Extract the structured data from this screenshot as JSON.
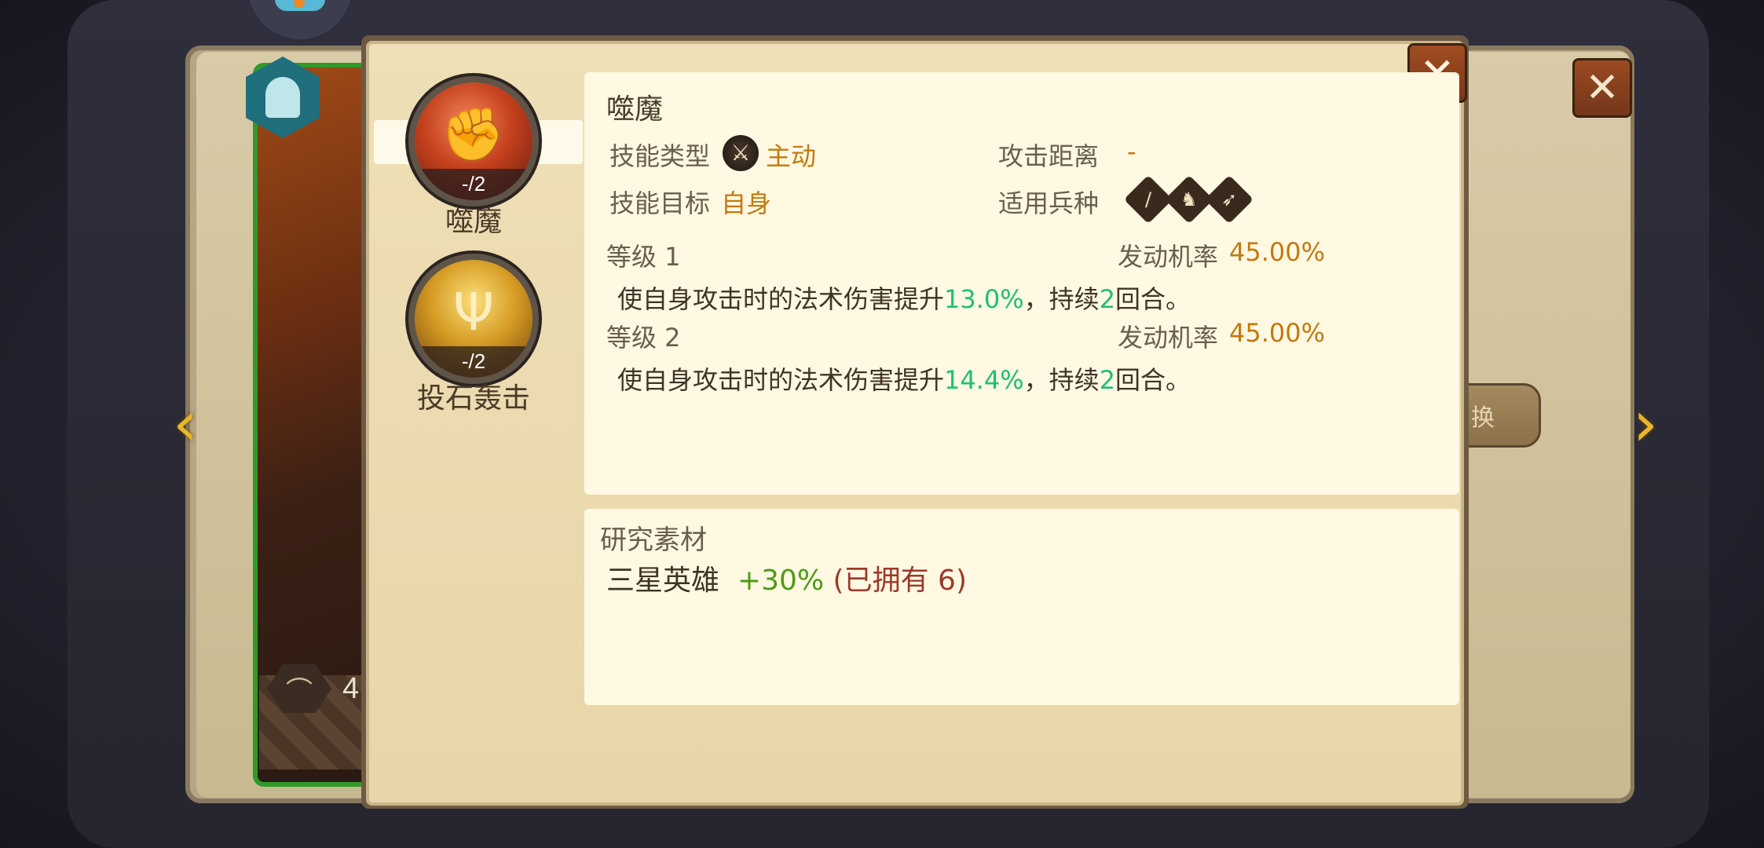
{
  "background": {
    "hero_stat_value": "4",
    "switch_button_label": "换",
    "close_label": "✕",
    "left_arrow": "‹",
    "right_arrow": "›"
  },
  "dialog": {
    "close_label": "✕",
    "skills": [
      {
        "name": "噬魔",
        "level_badge": "-/2",
        "icon": "fist-icon",
        "selected": true
      },
      {
        "name": "投石轰击",
        "level_badge": "-/2",
        "icon": "trident-icon",
        "selected": false
      }
    ],
    "detail": {
      "title": "噬魔",
      "skill_type_label": "技能类型",
      "skill_type_value": "主动",
      "attack_range_label": "攻击距离",
      "attack_range_value": "-",
      "skill_target_label": "技能目标",
      "skill_target_value": "自身",
      "troop_types_label": "适用兵种",
      "troop_types": [
        "sword-icon",
        "horse-icon",
        "bow-icon"
      ],
      "levels": [
        {
          "label": "等级 1",
          "rate_label": "发动机率",
          "rate_value": "45.00%",
          "desc_prefix": "使自身攻击时的法术伤害提升",
          "desc_value": "13.0%",
          "desc_mid": "，持续",
          "desc_turns": "2",
          "desc_suffix": "回合。"
        },
        {
          "label": "等级 2",
          "rate_label": "发动机率",
          "rate_value": "45.00%",
          "desc_prefix": "使自身攻击时的法术伤害提升",
          "desc_value": "14.4%",
          "desc_mid": "，持续",
          "desc_turns": "2",
          "desc_suffix": "回合。"
        }
      ]
    },
    "research": {
      "title": "研究素材",
      "material_name": "三星英雄",
      "material_bonus": "+30%",
      "owned_text": "(已拥有 6)"
    }
  },
  "colors": {
    "accent_gold": "#c27a0e",
    "value_green": "#1fbf76",
    "bonus_green": "#4f9a16",
    "owned_red": "#9a3a2a",
    "panel_cream": "#fff8e2",
    "dialog_tan": "#efdfb6"
  }
}
